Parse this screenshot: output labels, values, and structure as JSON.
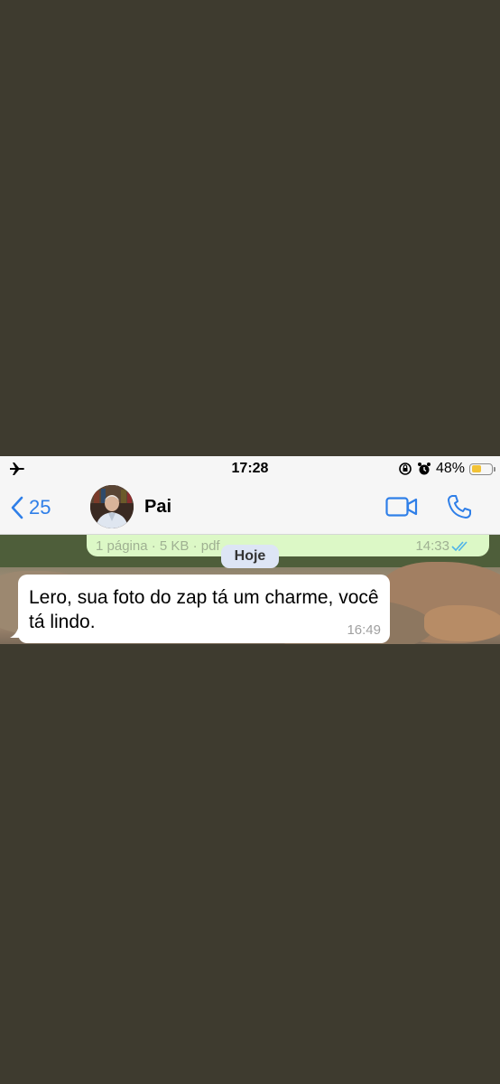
{
  "status_bar": {
    "time": "17:28",
    "battery_percent": "48%",
    "battery_level": 0.48,
    "icons": [
      "airplane-icon",
      "orientation-lock-icon",
      "alarm-icon",
      "battery-icon"
    ]
  },
  "header": {
    "back_count": "25",
    "contact_name": "Pai",
    "icons": [
      "back-chevron-icon",
      "video-call-icon",
      "phone-icon"
    ]
  },
  "colors": {
    "accent": "#2f7fe8",
    "outgoing_bubble": "#dcf8c6",
    "incoming_bubble": "#ffffff",
    "battery": "#f2c236",
    "backdrop": "#3e3b2f"
  },
  "messages": {
    "outgoing_document": {
      "meta": "1 página · 5 KB · pdf",
      "time": "14:33",
      "status": "double-check-icon"
    },
    "date_separator": "Hoje",
    "incoming": {
      "text": "Lero, sua foto do zap tá um charme, você tá lindo.",
      "time": "16:49"
    }
  }
}
